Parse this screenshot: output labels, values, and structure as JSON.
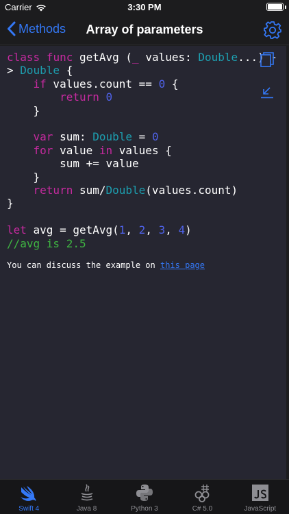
{
  "status_bar": {
    "carrier": "Carrier",
    "time": "3:30 PM",
    "battery_level": 1.0
  },
  "nav": {
    "back_label": "Methods",
    "title": "Array of parameters"
  },
  "code": {
    "lines": [
      "class func getAvg (_ values: Double...) -",
      "> Double {",
      "    if values.count == 0 {",
      "        return 0",
      "    }",
      "",
      "    var sum: Double = 0",
      "    for value in values {",
      "        sum += value",
      "    }",
      "    return sum/Double(values.count)",
      "}",
      "",
      "let avg = getAvg(1, 2, 3, 4)",
      "//avg is 2.5"
    ]
  },
  "discussion": {
    "text": "You can discuss the example on ",
    "link_text": "this page"
  },
  "tabs": [
    {
      "label": "Swift 4",
      "icon": "swift-icon",
      "active": true
    },
    {
      "label": "Java 8",
      "icon": "java-icon",
      "active": false
    },
    {
      "label": "Python 3",
      "icon": "python-icon",
      "active": false
    },
    {
      "label": "C# 5.0",
      "icon": "csharp-icon",
      "active": false
    },
    {
      "label": "JavaScript",
      "icon": "javascript-icon",
      "active": false
    }
  ],
  "colors": {
    "accent": "#3478f6",
    "keyword": "#c72aa0",
    "type": "#1d9fb0",
    "number": "#4f62e8",
    "comment": "#3fb542",
    "code_background": "#262631"
  }
}
